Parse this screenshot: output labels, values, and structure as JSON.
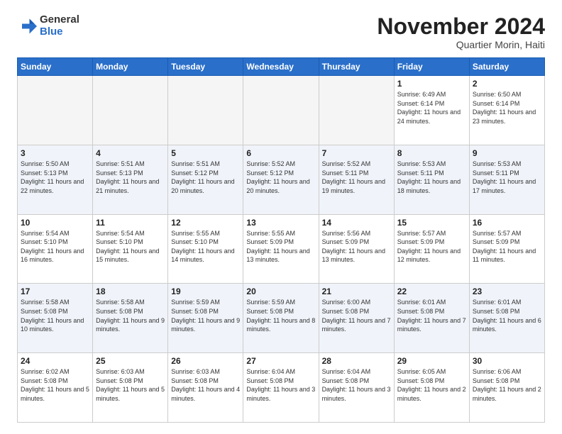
{
  "logo": {
    "general": "General",
    "blue": "Blue"
  },
  "header": {
    "month": "November 2024",
    "location": "Quartier Morin, Haiti"
  },
  "weekdays": [
    "Sunday",
    "Monday",
    "Tuesday",
    "Wednesday",
    "Thursday",
    "Friday",
    "Saturday"
  ],
  "weeks": [
    [
      {
        "day": "",
        "empty": true
      },
      {
        "day": "",
        "empty": true
      },
      {
        "day": "",
        "empty": true
      },
      {
        "day": "",
        "empty": true
      },
      {
        "day": "",
        "empty": true
      },
      {
        "day": "1",
        "rise": "6:49 AM",
        "set": "6:14 PM",
        "daylight": "11 hours and 24 minutes."
      },
      {
        "day": "2",
        "rise": "6:50 AM",
        "set": "6:14 PM",
        "daylight": "11 hours and 23 minutes."
      }
    ],
    [
      {
        "day": "3",
        "rise": "5:50 AM",
        "set": "5:13 PM",
        "daylight": "11 hours and 22 minutes."
      },
      {
        "day": "4",
        "rise": "5:51 AM",
        "set": "5:13 PM",
        "daylight": "11 hours and 21 minutes."
      },
      {
        "day": "5",
        "rise": "5:51 AM",
        "set": "5:12 PM",
        "daylight": "11 hours and 20 minutes."
      },
      {
        "day": "6",
        "rise": "5:52 AM",
        "set": "5:12 PM",
        "daylight": "11 hours and 20 minutes."
      },
      {
        "day": "7",
        "rise": "5:52 AM",
        "set": "5:11 PM",
        "daylight": "11 hours and 19 minutes."
      },
      {
        "day": "8",
        "rise": "5:53 AM",
        "set": "5:11 PM",
        "daylight": "11 hours and 18 minutes."
      },
      {
        "day": "9",
        "rise": "5:53 AM",
        "set": "5:11 PM",
        "daylight": "11 hours and 17 minutes."
      }
    ],
    [
      {
        "day": "10",
        "rise": "5:54 AM",
        "set": "5:10 PM",
        "daylight": "11 hours and 16 minutes."
      },
      {
        "day": "11",
        "rise": "5:54 AM",
        "set": "5:10 PM",
        "daylight": "11 hours and 15 minutes."
      },
      {
        "day": "12",
        "rise": "5:55 AM",
        "set": "5:10 PM",
        "daylight": "11 hours and 14 minutes."
      },
      {
        "day": "13",
        "rise": "5:55 AM",
        "set": "5:09 PM",
        "daylight": "11 hours and 13 minutes."
      },
      {
        "day": "14",
        "rise": "5:56 AM",
        "set": "5:09 PM",
        "daylight": "11 hours and 13 minutes."
      },
      {
        "day": "15",
        "rise": "5:57 AM",
        "set": "5:09 PM",
        "daylight": "11 hours and 12 minutes."
      },
      {
        "day": "16",
        "rise": "5:57 AM",
        "set": "5:09 PM",
        "daylight": "11 hours and 11 minutes."
      }
    ],
    [
      {
        "day": "17",
        "rise": "5:58 AM",
        "set": "5:08 PM",
        "daylight": "11 hours and 10 minutes."
      },
      {
        "day": "18",
        "rise": "5:58 AM",
        "set": "5:08 PM",
        "daylight": "11 hours and 9 minutes."
      },
      {
        "day": "19",
        "rise": "5:59 AM",
        "set": "5:08 PM",
        "daylight": "11 hours and 9 minutes."
      },
      {
        "day": "20",
        "rise": "5:59 AM",
        "set": "5:08 PM",
        "daylight": "11 hours and 8 minutes."
      },
      {
        "day": "21",
        "rise": "6:00 AM",
        "set": "5:08 PM",
        "daylight": "11 hours and 7 minutes."
      },
      {
        "day": "22",
        "rise": "6:01 AM",
        "set": "5:08 PM",
        "daylight": "11 hours and 7 minutes."
      },
      {
        "day": "23",
        "rise": "6:01 AM",
        "set": "5:08 PM",
        "daylight": "11 hours and 6 minutes."
      }
    ],
    [
      {
        "day": "24",
        "rise": "6:02 AM",
        "set": "5:08 PM",
        "daylight": "11 hours and 5 minutes."
      },
      {
        "day": "25",
        "rise": "6:03 AM",
        "set": "5:08 PM",
        "daylight": "11 hours and 5 minutes."
      },
      {
        "day": "26",
        "rise": "6:03 AM",
        "set": "5:08 PM",
        "daylight": "11 hours and 4 minutes."
      },
      {
        "day": "27",
        "rise": "6:04 AM",
        "set": "5:08 PM",
        "daylight": "11 hours and 3 minutes."
      },
      {
        "day": "28",
        "rise": "6:04 AM",
        "set": "5:08 PM",
        "daylight": "11 hours and 3 minutes."
      },
      {
        "day": "29",
        "rise": "6:05 AM",
        "set": "5:08 PM",
        "daylight": "11 hours and 2 minutes."
      },
      {
        "day": "30",
        "rise": "6:06 AM",
        "set": "5:08 PM",
        "daylight": "11 hours and 2 minutes."
      }
    ]
  ]
}
